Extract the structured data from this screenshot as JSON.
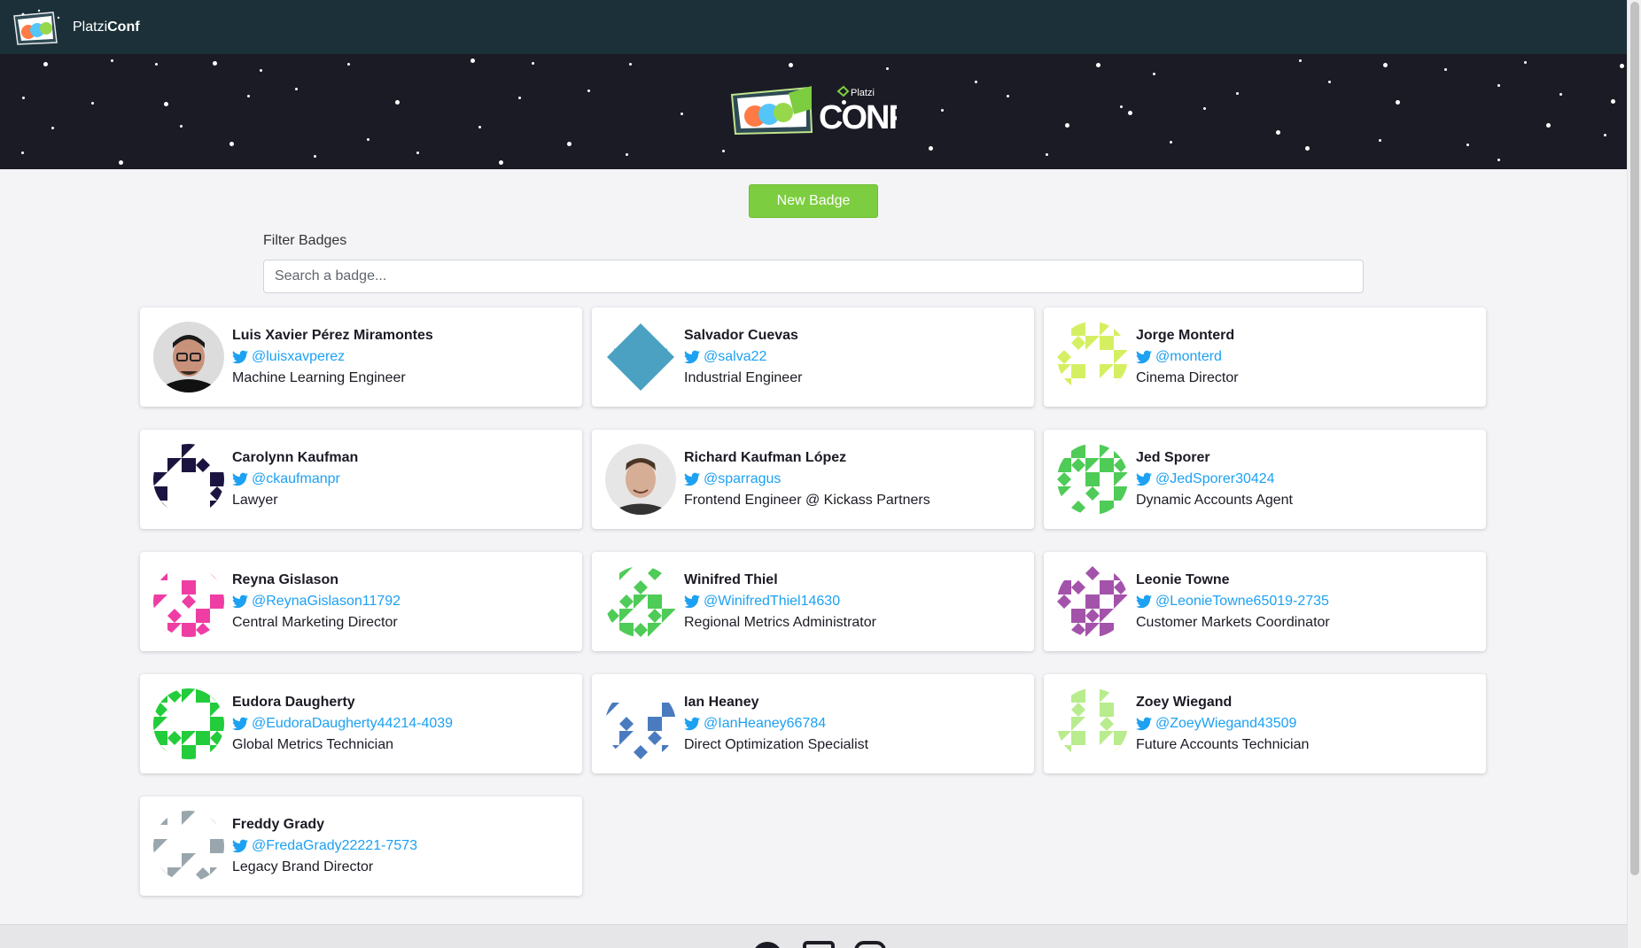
{
  "navbar": {
    "brand_light": "Platzi",
    "brand_bold": "Conf"
  },
  "hero": {
    "logo_small": "Platzi",
    "logo_big": "CONF"
  },
  "actions": {
    "new_badge_label": "New Badge"
  },
  "filter": {
    "label": "Filter Badges",
    "placeholder": "Search a badge..."
  },
  "colors": {
    "navbar": "#1b3039",
    "hero": "#1b1b25",
    "button": "#7dcd40",
    "twitter": "#1da1f2"
  },
  "badges": [
    {
      "name": "Luis Xavier Pérez Miramontes",
      "twitter": "@luisxavperez",
      "job": "Machine Learning Engineer",
      "avatar": "photo-man-glasses"
    },
    {
      "name": "Salvador Cuevas",
      "twitter": "@salva22",
      "job": "Industrial Engineer",
      "avatar": "identicon-blue-diamond"
    },
    {
      "name": "Jorge Monterd",
      "twitter": "@monterd",
      "job": "Cinema Director",
      "avatar": "identicon-lime"
    },
    {
      "name": "Carolynn Kaufman",
      "twitter": "@ckaufmanpr",
      "job": "Lawyer",
      "avatar": "identicon-navy"
    },
    {
      "name": "Richard Kaufman López",
      "twitter": "@sparragus",
      "job": "Frontend Engineer @ Kickass Partners",
      "avatar": "photo-man-smiling"
    },
    {
      "name": "Jed Sporer",
      "twitter": "@JedSporer30424",
      "job": "Dynamic Accounts Agent",
      "avatar": "identicon-green"
    },
    {
      "name": "Reyna Gislason",
      "twitter": "@ReynaGislason11792",
      "job": "Central Marketing Director",
      "avatar": "identicon-pink"
    },
    {
      "name": "Winifred Thiel",
      "twitter": "@WinifredThiel14630",
      "job": "Regional Metrics Administrator",
      "avatar": "identicon-green"
    },
    {
      "name": "Leonie Towne",
      "twitter": "@LeonieTowne65019-2735",
      "job": "Customer Markets Coordinator",
      "avatar": "identicon-purple"
    },
    {
      "name": "Eudora Daugherty",
      "twitter": "@EudoraDaugherty44214-4039",
      "job": "Global Metrics Technician",
      "avatar": "identicon-bright-green"
    },
    {
      "name": "Ian Heaney",
      "twitter": "@IanHeaney66784",
      "job": "Direct Optimization Specialist",
      "avatar": "identicon-blue"
    },
    {
      "name": "Zoey Wiegand",
      "twitter": "@ZoeyWiegand43509",
      "job": "Future Accounts Technician",
      "avatar": "identicon-light-green"
    },
    {
      "name": "Freddy Grady",
      "twitter": "@FredaGrady22221-7573",
      "job": "Legacy Brand Director",
      "avatar": "identicon-gray"
    }
  ],
  "footer": {
    "icons": [
      "twitter-icon",
      "tablet-icon",
      "instagram-icon"
    ]
  }
}
